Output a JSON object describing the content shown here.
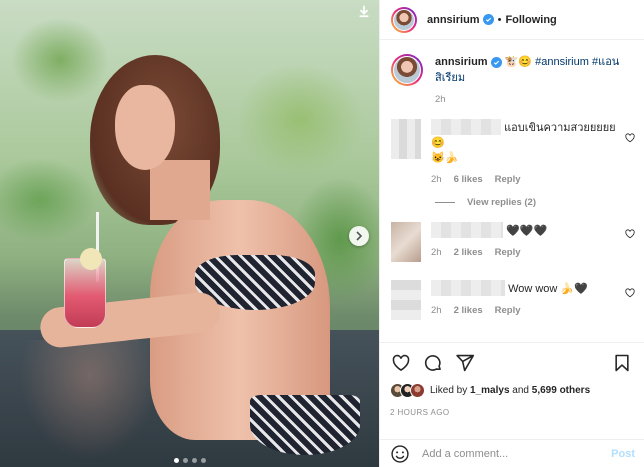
{
  "post": {
    "media_alt": "",
    "carousel": {
      "count": 4,
      "active_index": 0
    }
  },
  "header": {
    "username": "annsirium",
    "separator": "•",
    "follow_status": "Following"
  },
  "caption": {
    "username": "annsirium",
    "emojis": "🐮😊",
    "hashtag1": "#annsirium",
    "hashtag2": "#แอนสิเรียม",
    "time": "2h"
  },
  "comments": [
    {
      "text": "แอบเขินความสวยยยยย😊",
      "text2": "😺🍌",
      "time": "2h",
      "likes": "6 likes",
      "reply": "Reply"
    },
    {
      "text": "🖤🖤🖤",
      "time": "2h",
      "likes": "2 likes",
      "reply": "Reply"
    },
    {
      "text": "Wow wow 🍌🖤",
      "time": "2h",
      "likes": "2 likes",
      "reply": "Reply"
    }
  ],
  "view_replies": "View replies (2)",
  "likes": {
    "prefix": "Liked by ",
    "user": "1_malys",
    "middle": " and ",
    "others": "5,699 others"
  },
  "posted_ago": "2 HOURS AGO",
  "add_comment": {
    "placeholder": "Add a comment...",
    "post_label": "Post"
  },
  "icons": {
    "heart": "heart-icon",
    "comment": "comment-icon",
    "share": "share-icon",
    "save": "bookmark-icon",
    "emoji": "emoji-icon",
    "next": "chevron-right-icon"
  },
  "colors": {
    "verified": "#3897f0",
    "hashtag": "#00376b",
    "post_disabled": "#b2dffc"
  }
}
